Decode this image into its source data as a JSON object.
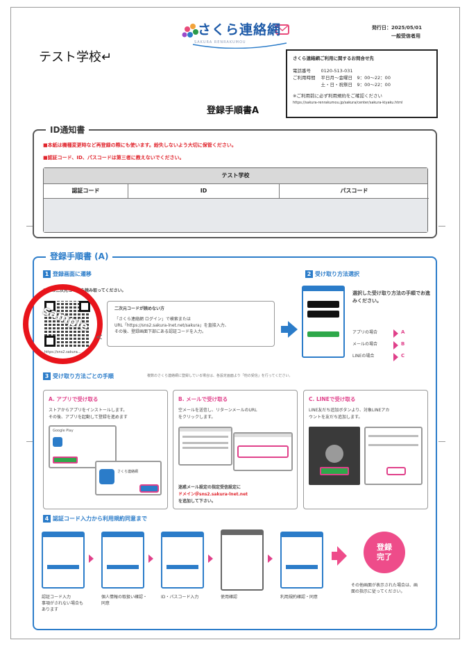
{
  "header": {
    "brand_name": "さくら連絡網",
    "brand_sub": "SAKURA RENRAKUMOU",
    "issue_date": "発行日：2025/05/01",
    "issue_audience": "一般受信者用",
    "school_name": "テスト学校↵"
  },
  "inquiry_box": {
    "title": "さくら連絡網ご利用に関するお問合せ先",
    "phone_label": "電話番号",
    "phone_value": "0120-513-031",
    "hours_label": "ご利用時間",
    "hours_weekday": "平日月～金曜日　9：00～22：00",
    "hours_weekend": "土・日・祝祭日　9：00～22：00",
    "note": "※ご利用前に必ず利用規約をご確認ください",
    "url": "https://sakura-renrakumou.jp/sakura/center/sakura-kiyaku.html"
  },
  "document_title": "登録手順書A",
  "id_notice": {
    "legend": "ID通知書",
    "warning1": "■本紙は機種変更時など再登録の際にも使います。紛失しないよう大切に保管ください。",
    "warning2": "■認証コード、ID、パスコードは第三者に教えないでください。",
    "table_school": "テスト学校",
    "col_auth": "認証コード",
    "col_id": "ID",
    "col_pass": "パスコード"
  },
  "procedure": {
    "legend": "登録手順書 (A)",
    "step1_num": "1",
    "step1_title": "登録画面に遷移",
    "step1_instr": "以下の二次元コードを読み取ってください。",
    "sample_label": "sample",
    "qr_url": "https://sns2.sakura...",
    "noread_title": "二次元コードが読めない方",
    "noread_body1": "「さくら連絡網 ログイン」で検索または",
    "noread_body2": "URL「https://sns2.sakura-lnet.net/sakura」を直接入力、",
    "noread_body3": "その後、登録画面下部にある認証コードを入力。",
    "step2_num": "2",
    "step2_title": "受け取り方法選択",
    "step2_desc": "選択した受け取り方法の手順でお進みください。",
    "step2_app": "アプリの場合",
    "step2_app_key": "A",
    "step2_mail": "メールの場合",
    "step2_mail_key": "B",
    "step2_line": "LINEの場合",
    "step2_line_key": "C",
    "step3_num": "3",
    "step3_title": "受け取り方法ごとの手順",
    "step3_note": "複数のさくら連絡網に登録している場合は、各設定画面より「他の受信」を行ってください。",
    "a_title": "A. アプリで受け取る",
    "a_body1": "ストアからアプリをインストールします。",
    "a_body2": "その後、アプリを起動して登録を進めます",
    "a_store": "Google Play",
    "a_app_name": "さくら連絡網",
    "b_title": "B. メールで受け取る",
    "b_body1": "空メールを送信し、リターンメールのURL",
    "b_body2": "をクリックします。",
    "b_foot1": "迷惑メール設定の指定受信設定に",
    "b_foot2": "ドメイン＠sns2.sakura-lnet.net",
    "b_foot3": "を追加して下さい。",
    "c_title": "C. LINEで受け取る",
    "c_body1": "LINE友だち追加ボタンより、対象LINEアカ",
    "c_body2": "ウントを友だち追加します。",
    "step4_num": "4",
    "step4_title": "認証コード入力から利用規約同意まで",
    "flow": [
      {
        "label": "認証コード入力",
        "note": "事項がされない場合もあります"
      },
      {
        "label": "個人情報の取扱い確認・同意",
        "note": ""
      },
      {
        "label": "ID・パスコード入力",
        "note": ""
      },
      {
        "label": "使用確認",
        "note": ""
      },
      {
        "label": "利用規約確認・同意",
        "note": ""
      }
    ],
    "done_line1": "登録",
    "done_line2": "完了",
    "done_note": "その他画面が表示された場合は、画面の指示に従ってください。"
  },
  "colors": {
    "accent_blue": "#2b7cc9",
    "warning_red": "#e0242c",
    "pink": "#ee4c8a",
    "sample_circle": "#e8141b"
  }
}
